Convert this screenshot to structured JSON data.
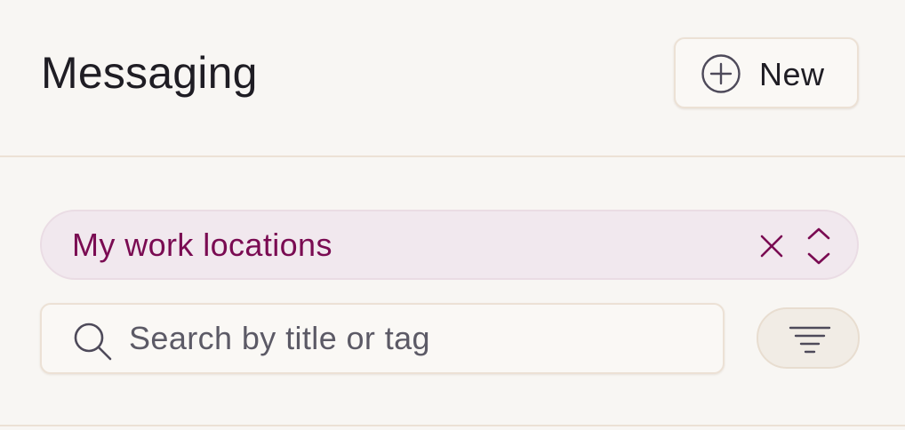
{
  "header": {
    "title": "Messaging",
    "new_button_label": "New",
    "new_button_icon": "plus-circle-icon"
  },
  "location_filter": {
    "selected": "My work locations",
    "clear_icon": "close-icon",
    "chevron_icon": "chevron-up-down-icon",
    "text_color": "#7a0b52",
    "background": "#f1e8ee"
  },
  "search": {
    "placeholder": "Search by title or tag",
    "value": "",
    "icon": "search-icon"
  },
  "filter_button": {
    "icon": "filter-lines-icon"
  },
  "colors": {
    "background": "#f8f6f3",
    "border": "#ece1d5",
    "text": "#1f1d24",
    "accent": "#7a0b52"
  }
}
